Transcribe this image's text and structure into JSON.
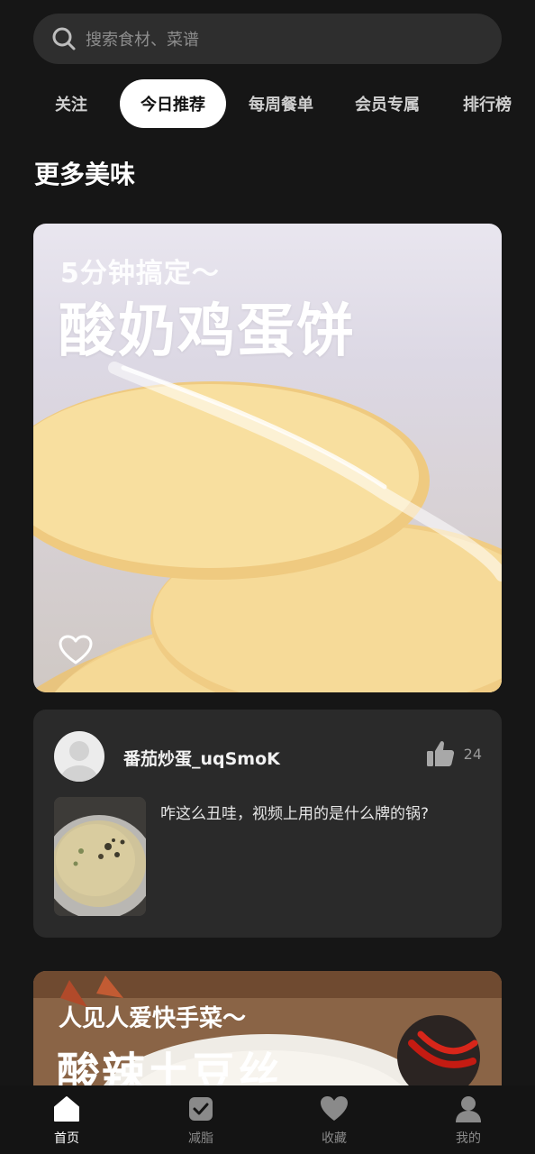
{
  "search": {
    "placeholder": "搜索食材、菜谱"
  },
  "tabs": [
    {
      "label": "关注"
    },
    {
      "label": "今日推荐",
      "active": true
    },
    {
      "label": "每周餐单"
    },
    {
      "label": "会员专属"
    },
    {
      "label": "排行榜"
    }
  ],
  "section": {
    "title": "更多美味"
  },
  "feature_card": {
    "kicker": "5分钟搞定～",
    "headline": "酸奶鸡蛋饼",
    "favorite_icon": "heart-outline-icon"
  },
  "comment": {
    "username": "番茄炒蛋_uqSmoK",
    "like_count": "24",
    "text": "咋这么丑哇，视频上用的是什么牌的锅?"
  },
  "second_card": {
    "kicker": "人见人爱快手菜～",
    "headline": "酸辣土豆丝"
  },
  "bottom_nav": {
    "items": [
      {
        "label": "首页",
        "icon": "home-icon",
        "active": true
      },
      {
        "label": "减脂",
        "icon": "shield-check-icon"
      },
      {
        "label": "收藏",
        "icon": "heart-icon"
      },
      {
        "label": "我的",
        "icon": "user-icon"
      }
    ]
  },
  "colors": {
    "background": "#161616",
    "active_tab_bg": "#ffffff",
    "card_bg": "#2a2a2a"
  }
}
